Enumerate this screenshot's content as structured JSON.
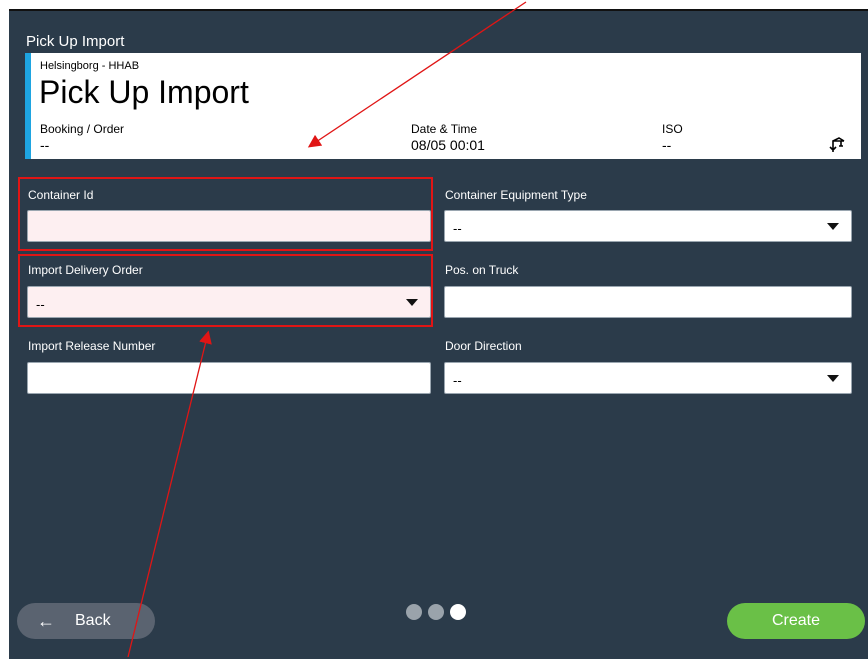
{
  "window": {
    "title": "Pick Up Import"
  },
  "header": {
    "location": "Helsingborg - HHAB",
    "title": "Pick Up Import",
    "booking_label": "Booking / Order",
    "booking_value": "--",
    "datetime_label": "Date & Time",
    "datetime_value": "08/05 00:01",
    "iso_label": "ISO",
    "iso_value": "--",
    "crane_icon": "crane-icon"
  },
  "form": {
    "container_id": {
      "label": "Container Id",
      "value": ""
    },
    "container_equipment_type": {
      "label": "Container Equipment Type",
      "value": "--"
    },
    "import_delivery_order": {
      "label": "Import Delivery Order",
      "value": "--"
    },
    "pos_on_truck": {
      "label": "Pos. on Truck",
      "value": ""
    },
    "import_release_number": {
      "label": "Import Release Number",
      "value": ""
    },
    "door_direction": {
      "label": "Door Direction",
      "value": "--"
    }
  },
  "footer": {
    "back_label": "Back",
    "back_icon": "arrow-left-icon",
    "create_label": "Create",
    "page_count": 3,
    "current_page": 3
  },
  "colors": {
    "background": "#2b3b4a",
    "accent": "#1ea4e1",
    "create": "#6ac047",
    "required_field": "#fdeff1",
    "annotation": "#e01515"
  }
}
